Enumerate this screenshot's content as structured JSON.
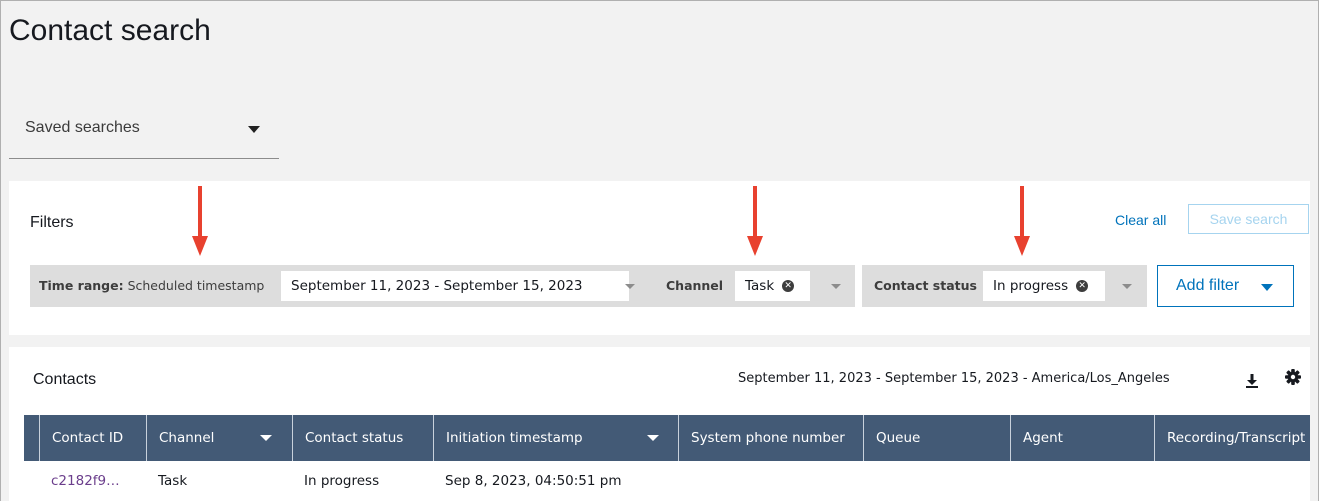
{
  "page": {
    "title": "Contact search"
  },
  "saved_searches": {
    "label": "Saved searches"
  },
  "filters": {
    "title": "Filters",
    "clear_all": "Clear all",
    "save_search": "Save search",
    "time_range": {
      "label_bold": "Time range:",
      "label_rest": " Scheduled timestamp",
      "value": "September 11, 2023 - September 15, 2023"
    },
    "channel": {
      "label": "Channel",
      "value": "Task"
    },
    "contact_status": {
      "label": "Contact status",
      "value": "In progress"
    },
    "add_filter": "Add filter"
  },
  "contacts": {
    "title": "Contacts",
    "range_text": "September 11, 2023 - September 15, 2023 - America/Los_Angeles",
    "columns": [
      "Contact ID",
      "Channel",
      "Contact status",
      "Initiation timestamp",
      "System phone number",
      "Queue",
      "Agent",
      "Recording/Transcript"
    ],
    "rows": [
      {
        "contact_id": "c2182f9…",
        "channel": "Task",
        "contact_status": "In progress",
        "initiation_timestamp": "Sep 8, 2023, 04:50:51 pm"
      }
    ]
  },
  "colors": {
    "link": "#0073bb",
    "header_bg": "#435a76",
    "annotation_arrow": "#e8412f",
    "contact_id_link": "#6b3e8c"
  },
  "icons": [
    "chevron-down-icon",
    "close-circle-icon",
    "download-icon",
    "gear-icon",
    "annotation-arrow-icon"
  ]
}
